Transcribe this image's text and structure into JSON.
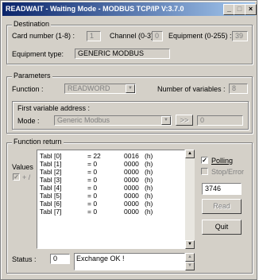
{
  "window": {
    "title": "READWAIT - Waiting Mode - MODBUS TCP/IP  V:3.7.0",
    "min_glyph": "_",
    "max_glyph": "□",
    "close_glyph": "×"
  },
  "destination": {
    "legend": "Destination",
    "card_label": "Card number (1-8) :",
    "card_value": "1",
    "channel_label": "Channel (0-3) :",
    "channel_value": "0",
    "equipment_label": "Equipment (0-255) :",
    "equipment_value": "39",
    "type_label": "Equipment type:",
    "type_value": "GENERIC MODBUS"
  },
  "parameters": {
    "legend": "Parameters",
    "function_label": "Function :",
    "function_value": "READWORD",
    "numvars_label": "Number of variables :",
    "numvars_value": "8",
    "first_addr_legend": "First variable address :",
    "mode_label": "Mode :",
    "mode_value": "Generic Modbus",
    "arrow_button": ">>",
    "address_value": "0"
  },
  "function_return": {
    "legend": "Function return",
    "values_label": "Values",
    "plusminus_label": "+ /",
    "rows": [
      {
        "name": "Tabl [0]",
        "eq": "= 22",
        "hex": "0016",
        "unit": "(h)"
      },
      {
        "name": "Tabl [1]",
        "eq": "= 0",
        "hex": "0000",
        "unit": "(h)"
      },
      {
        "name": "Tabl [2]",
        "eq": "= 0",
        "hex": "0000",
        "unit": "(h)"
      },
      {
        "name": "Tabl [3]",
        "eq": "= 0",
        "hex": "0000",
        "unit": "(h)"
      },
      {
        "name": "Tabl [4]",
        "eq": "= 0",
        "hex": "0000",
        "unit": "(h)"
      },
      {
        "name": "Tabl [5]",
        "eq": "= 0",
        "hex": "0000",
        "unit": "(h)"
      },
      {
        "name": "Tabl [6]",
        "eq": "= 0",
        "hex": "0000",
        "unit": "(h)"
      },
      {
        "name": "Tabl [7]",
        "eq": "= 0",
        "hex": "0000",
        "unit": "(h)"
      }
    ],
    "status_label": "Status :",
    "status_code": "0",
    "status_text": "Exchange OK !"
  },
  "side": {
    "polling_label": "Polling",
    "polling_checked": true,
    "stop_error_label": "Stop/Error",
    "counter_value": "3746",
    "read_button": "Read",
    "quit_button": "Quit"
  }
}
